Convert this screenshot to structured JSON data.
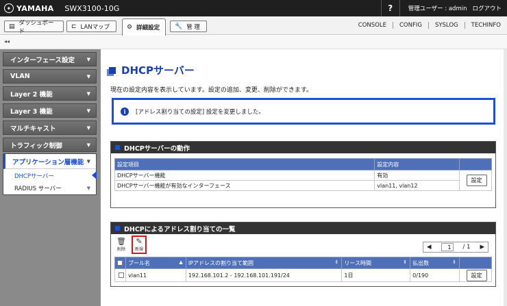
{
  "header": {
    "brand": "YAMAHA",
    "model": "SWX3100-10G",
    "help": "?",
    "user": "管理ユーザー : admin",
    "logout": "ログアウト"
  },
  "nav": {
    "dashboard": "ダッシュボード",
    "lanmap": "LANマップ",
    "detail": "詳細設定",
    "manage": "管 理",
    "links": [
      "CONSOLE",
      "CONFIG",
      "SYSLOG",
      "TECHINFO"
    ]
  },
  "collapse": "◂◂",
  "sidebar": {
    "items": [
      "インターフェース設定",
      "VLAN",
      "Layer 2 機能",
      "Layer 3 機能",
      "マルチキャスト",
      "トラフィック制御"
    ],
    "group_title": "アプリケーション層機能",
    "subitems": [
      "DHCPサーバー",
      "RADIUS サーバー"
    ]
  },
  "main": {
    "title": "DHCPサーバー",
    "desc": "現在の設定内容を表示しています。設定の追加、変更、削除ができます。",
    "notice": "[アドレス割り当ての設定] 設定を変更しました。",
    "section1": {
      "title": "DHCPサーバーの動作",
      "headers": [
        "設定項目",
        "設定内容"
      ],
      "rows": [
        [
          "DHCPサーバー機能",
          "有効"
        ],
        [
          "DHCPサーバー機能が有効なインターフェース",
          "vlan11, vlan12"
        ]
      ],
      "button": "設定"
    },
    "section2": {
      "title": "DHCPによるアドレス割り当ての一覧",
      "delete_label": "削除",
      "new_label": "新規",
      "pager_current": "1",
      "pager_total": "/ 1",
      "headers": [
        "プール名",
        "IPアドレスの割り当て範囲",
        "リース時間",
        "払出数"
      ],
      "rows": [
        {
          "pool": "vlan11",
          "range": "192.168.101.2 - 192.168.101.191/24",
          "lease": "1日",
          "count": "0/190",
          "button": "設定"
        }
      ]
    }
  }
}
